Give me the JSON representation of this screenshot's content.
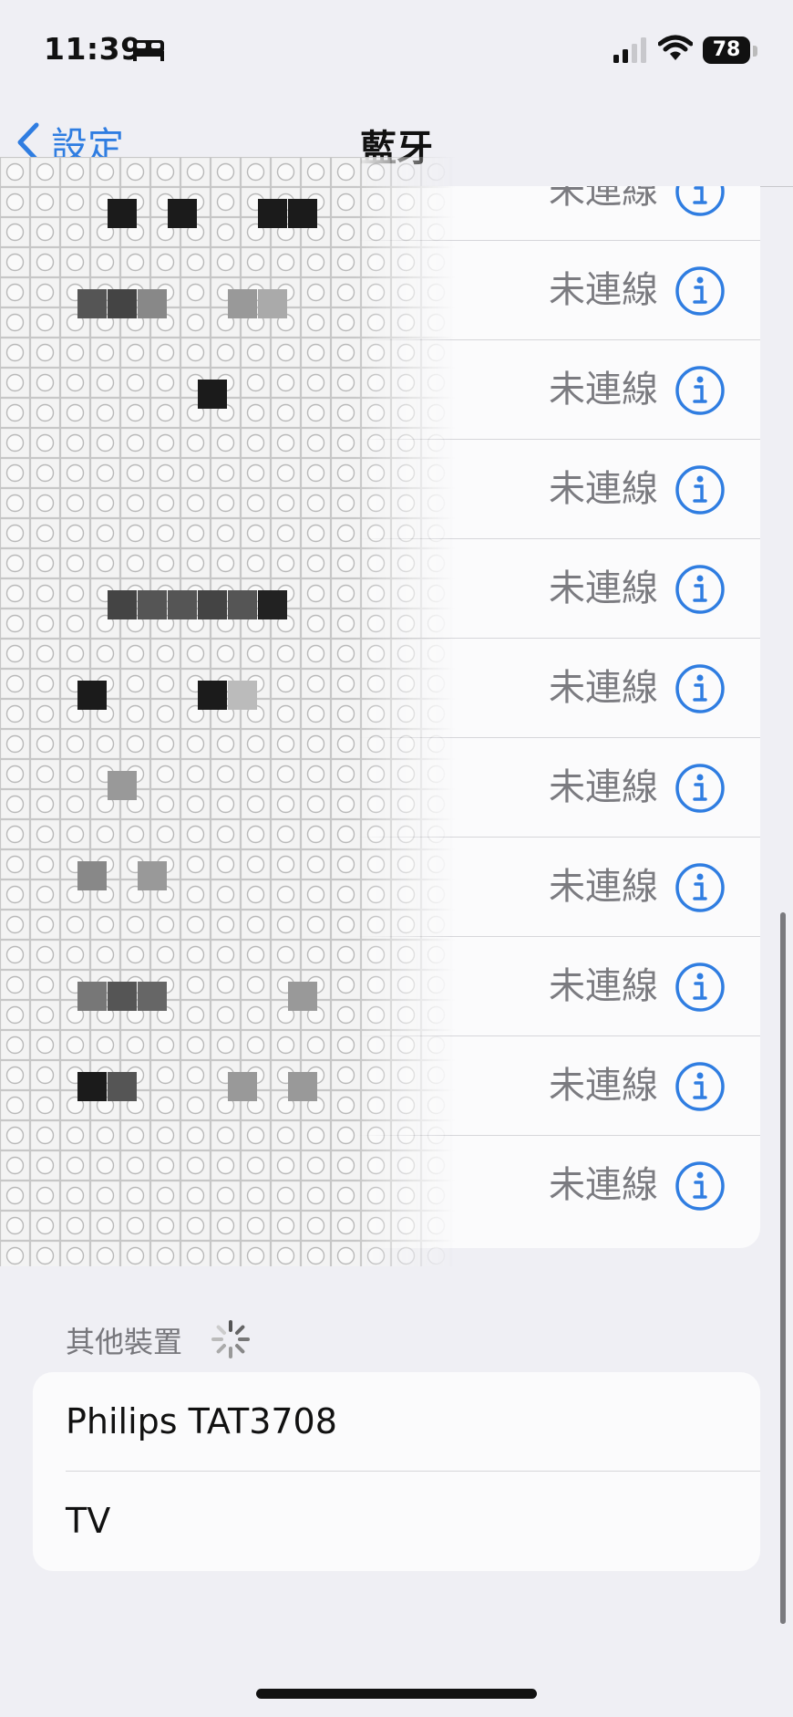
{
  "status_bar": {
    "time": "11:39",
    "battery": "78",
    "icons": [
      "bed-icon",
      "signal-icon",
      "wifi-icon",
      "battery-icon"
    ]
  },
  "nav": {
    "back_label": "設定",
    "title": "藍牙"
  },
  "my_devices": {
    "rows": [
      {
        "status": "未連線"
      },
      {
        "status": "未連線"
      },
      {
        "status": "未連線"
      },
      {
        "status": "未連線"
      },
      {
        "status": "未連線"
      },
      {
        "status": "未連線"
      },
      {
        "status": "未連線"
      },
      {
        "status": "未連線"
      },
      {
        "status": "未連線"
      },
      {
        "status": "未連線"
      },
      {
        "status": "未連線"
      }
    ]
  },
  "other_devices": {
    "header": "其他裝置",
    "items": [
      {
        "name": "Philips TAT3708"
      },
      {
        "name": "TV"
      }
    ]
  },
  "colors": {
    "accent": "#2f7de1",
    "background": "#efeff4",
    "card": "#fbfbfc",
    "secondary_text": "#7b7b80"
  }
}
